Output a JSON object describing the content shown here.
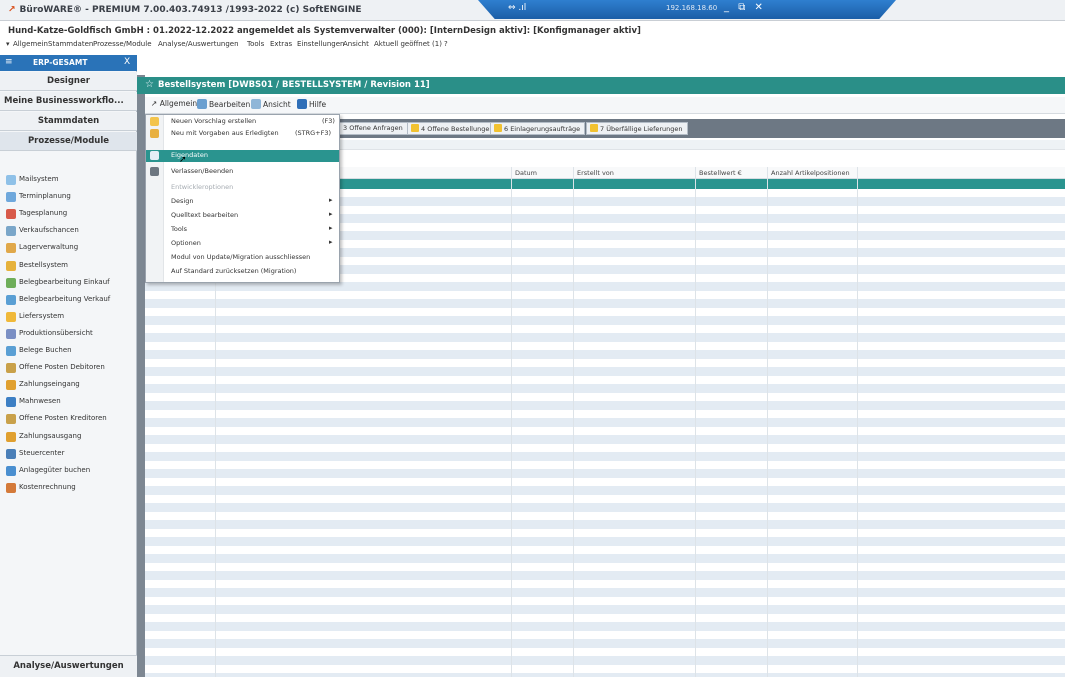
{
  "window": {
    "title": "BüroWARE® - PREMIUM 7.00.403.74913 /1993-2022 (c) SoftENGINE",
    "logo": "↗",
    "info_line": "Hund-Katze-Goldfisch GmbH : 01.2022-12.2022 angemeldet als Systemverwalter (000): [InternDesign aktiv]: [Konfigmanager aktiv]"
  },
  "remote": {
    "signal": "⇔ .ıl",
    "ip": "192.168.18.60",
    "minimize": "_",
    "restore": "⧉",
    "close": "✕"
  },
  "menubar": {
    "arrow": "▾",
    "items": [
      "Allgemein",
      "Stammdaten",
      "Prozesse/Module",
      "Analyse/Auswertungen",
      "Tools",
      "Extras",
      "Einstellungen",
      "Ansicht",
      "Aktuell geöffnet (1)",
      "?"
    ]
  },
  "left_panel": {
    "erp_menu_icon": "≡",
    "erp_title": "ERP-GESAMT",
    "erp_close": "X",
    "designer": "Designer",
    "workflows": "Meine Businessworkflo...",
    "stammdaten": "Stammdaten",
    "prozesse": "Prozesse/Module",
    "analyse": "Analyse/Auswertungen",
    "items": [
      {
        "label": "Mailsystem",
        "color": "#8fc1e8"
      },
      {
        "label": "Terminplanung",
        "color": "#6fa8dc"
      },
      {
        "label": "Tagesplanung",
        "color": "#d85a4a"
      },
      {
        "label": "Verkaufschancen",
        "color": "#7aa6c9"
      },
      {
        "label": "Lagerverwaltung",
        "color": "#e0a84a"
      },
      {
        "label": "Bestellsystem",
        "color": "#e6b23c"
      },
      {
        "label": "Belegbearbeitung Einkauf",
        "color": "#6fae5a"
      },
      {
        "label": "Belegbearbeitung Verkauf",
        "color": "#5a9fd4"
      },
      {
        "label": "Liefersystem",
        "color": "#f0b93a"
      },
      {
        "label": "Produktionsübersicht",
        "color": "#7a8fc4"
      },
      {
        "label": "Belege Buchen",
        "color": "#5a9fd4"
      },
      {
        "label": "Offene Posten Debitoren",
        "color": "#c9a14a"
      },
      {
        "label": "Zahlungseingang",
        "color": "#e0a030"
      },
      {
        "label": "Mahnwesen",
        "color": "#3d7fc4"
      },
      {
        "label": "Offene Posten Kreditoren",
        "color": "#c9a14a"
      },
      {
        "label": "Zahlungsausgang",
        "color": "#e0a030"
      },
      {
        "label": "Steuercenter",
        "color": "#4a7fb8"
      },
      {
        "label": "Anlagegüter buchen",
        "color": "#4a8fd0"
      },
      {
        "label": "Kostenrechnung",
        "color": "#d47a3a"
      }
    ]
  },
  "main": {
    "star": "☆",
    "title": "Bestellsystem [DWBS01 / BESTELLSYSTEM / Revision 11]",
    "toolbar": {
      "allgemein": "Allgemein",
      "bearbeiten": "Bearbeiten",
      "ansicht": "Ansicht",
      "hilfe": "Hilfe",
      "allgemein_icon": "↗"
    },
    "tabs": [
      "3 Offene Anfragen",
      "4 Offene Bestellungen",
      "6 Einlagerungsaufträge",
      "7 Überfällige Lieferungen"
    ],
    "columns": [
      "Datum",
      "Erstellt von",
      "Bestellwert €",
      "Anzahl Artikelpositionen"
    ]
  },
  "context_menu": {
    "items": [
      {
        "label": "Neuen Vorschlag erstellen",
        "shortcut": "(F3)"
      },
      {
        "label": "Neu mit Vorgaben aus Erledigten",
        "shortcut": "(STRG+F3)"
      },
      {
        "label": "Eigendaten",
        "highlighted": true
      },
      {
        "label": "Verlassen/Beenden"
      },
      {
        "label": "Entwickleroptionen",
        "disabled": true
      },
      {
        "label": "Design",
        "submenu": "▸"
      },
      {
        "label": "Quelltext bearbeiten",
        "submenu": "▸"
      },
      {
        "label": "Tools",
        "submenu": "▸"
      },
      {
        "label": "Optionen",
        "submenu": "▸"
      },
      {
        "label": "Modul von Update/Migration ausschliessen"
      },
      {
        "label": "Auf Standard zurücksetzen (Migration)"
      }
    ]
  }
}
